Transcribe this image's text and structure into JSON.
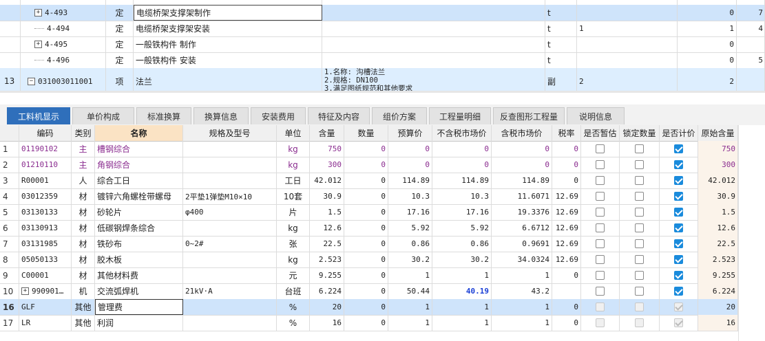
{
  "upper": {
    "rows": [
      {
        "num": "",
        "toggle": "+",
        "code": "4-493",
        "type": "定",
        "name": "电缆桥架支撑架制作",
        "spec": "",
        "unit": "t",
        "qty": "",
        "total": "0",
        "extra": "7",
        "selected": true
      },
      {
        "num": "",
        "toggle": "",
        "code": "4-494",
        "type": "定",
        "name": "电缆桥架支撑架安装",
        "spec": "",
        "unit": "t",
        "qty": "1",
        "total": "1",
        "extra": "4",
        "selected": false
      },
      {
        "num": "",
        "toggle": "+",
        "code": "4-495",
        "type": "定",
        "name": "一般铁构件 制作",
        "spec": "",
        "unit": "t",
        "qty": "",
        "total": "0",
        "extra": "",
        "selected": false
      },
      {
        "num": "",
        "toggle": "",
        "code": "4-496",
        "type": "定",
        "name": "一般铁构件 安装",
        "spec": "",
        "unit": "t",
        "qty": "",
        "total": "0",
        "extra": "5",
        "selected": false
      }
    ],
    "item": {
      "num": "13",
      "toggle": "−",
      "code": "031003011001",
      "type": "项",
      "name": "法兰",
      "spec_lines": [
        "1.名称: 沟槽法兰",
        "2.规格: DN100",
        "3.满足图纸规范和其他要求"
      ],
      "unit": "副",
      "qty": "2",
      "total": "2"
    }
  },
  "tabs": [
    "工料机显示",
    "单价构成",
    "标准换算",
    "换算信息",
    "安装费用",
    "特征及内容",
    "组价方案",
    "工程量明细",
    "反查图形工程量",
    "说明信息"
  ],
  "grid": {
    "headers": [
      "",
      "编码",
      "类别",
      "名称",
      "规格及型号",
      "单位",
      "含量",
      "数量",
      "预算价",
      "不含税市场价",
      "含税市场价",
      "税率",
      "是否暂估",
      "锁定数量",
      "是否计价",
      "原始含量"
    ],
    "rows": [
      {
        "n": "1",
        "code": "01190102",
        "cat": "主",
        "name": "槽钢综合",
        "spec": "",
        "unit": "kg",
        "content": "750",
        "qty": "0",
        "budget": "0",
        "mkt_ex": "0",
        "mkt_in": "0",
        "tax": "0",
        "est": false,
        "lock": false,
        "priced": true,
        "orig": "750",
        "purple": true
      },
      {
        "n": "2",
        "code": "01210110",
        "cat": "主",
        "name": "角钢综合",
        "spec": "",
        "unit": "kg",
        "content": "300",
        "qty": "0",
        "budget": "0",
        "mkt_ex": "0",
        "mkt_in": "0",
        "tax": "0",
        "est": false,
        "lock": false,
        "priced": true,
        "orig": "300",
        "purple": true
      },
      {
        "n": "3",
        "code": "R00001",
        "cat": "人",
        "name": "综合工日",
        "spec": "",
        "unit": "工日",
        "content": "42.012",
        "qty": "0",
        "budget": "114.89",
        "mkt_ex": "114.89",
        "mkt_in": "114.89",
        "tax": "0",
        "est": false,
        "lock": false,
        "priced": true,
        "orig": "42.012"
      },
      {
        "n": "4",
        "code": "03012359",
        "cat": "材",
        "name": "镀锌六角螺栓带螺母",
        "spec": "2平垫1弹垫M10×10",
        "unit": "10套",
        "content": "30.9",
        "qty": "0",
        "budget": "10.3",
        "mkt_ex": "10.3",
        "mkt_in": "11.6071",
        "tax": "12.69",
        "est": false,
        "lock": false,
        "priced": true,
        "orig": "30.9"
      },
      {
        "n": "5",
        "code": "03130133",
        "cat": "材",
        "name": "砂轮片",
        "spec": "φ400",
        "unit": "片",
        "content": "1.5",
        "qty": "0",
        "budget": "17.16",
        "mkt_ex": "17.16",
        "mkt_in": "19.3376",
        "tax": "12.69",
        "est": false,
        "lock": false,
        "priced": true,
        "orig": "1.5"
      },
      {
        "n": "6",
        "code": "03130913",
        "cat": "材",
        "name": "低碳钢焊条综合",
        "spec": "",
        "unit": "kg",
        "content": "12.6",
        "qty": "0",
        "budget": "5.92",
        "mkt_ex": "5.92",
        "mkt_in": "6.6712",
        "tax": "12.69",
        "est": false,
        "lock": false,
        "priced": true,
        "orig": "12.6"
      },
      {
        "n": "7",
        "code": "03131985",
        "cat": "材",
        "name": "铁砂布",
        "spec": "0~2#",
        "unit": "张",
        "content": "22.5",
        "qty": "0",
        "budget": "0.86",
        "mkt_ex": "0.86",
        "mkt_in": "0.9691",
        "tax": "12.69",
        "est": false,
        "lock": false,
        "priced": true,
        "orig": "22.5"
      },
      {
        "n": "8",
        "code": "05050133",
        "cat": "材",
        "name": "胶木板",
        "spec": "",
        "unit": "kg",
        "content": "2.523",
        "qty": "0",
        "budget": "30.2",
        "mkt_ex": "30.2",
        "mkt_in": "34.0324",
        "tax": "12.69",
        "est": false,
        "lock": false,
        "priced": true,
        "orig": "2.523"
      },
      {
        "n": "9",
        "code": "C00001",
        "cat": "材",
        "name": "其他材料费",
        "spec": "",
        "unit": "元",
        "content": "9.255",
        "qty": "0",
        "budget": "1",
        "mkt_ex": "1",
        "mkt_in": "1",
        "tax": "0",
        "est": false,
        "lock": false,
        "priced": true,
        "orig": "9.255"
      },
      {
        "n": "10",
        "code": "990901…",
        "cat": "机",
        "name": "交流弧焊机",
        "spec": "21kV·A",
        "unit": "台班",
        "content": "6.224",
        "qty": "0",
        "budget": "50.44",
        "mkt_ex": "40.19",
        "mkt_in": "43.2",
        "tax": "",
        "est": false,
        "lock": false,
        "priced": true,
        "orig": "6.224",
        "toggle": "+",
        "bluebold": true
      },
      {
        "n": "16",
        "code": "GLF",
        "cat": "其他",
        "name": "管理费",
        "spec": "",
        "unit": "%",
        "content": "20",
        "qty": "0",
        "budget": "1",
        "mkt_ex": "1",
        "mkt_in": "1",
        "tax": "0",
        "est": false,
        "lock": false,
        "priced": true,
        "orig": "20",
        "selected": true,
        "disabled": true,
        "boldnum": true
      },
      {
        "n": "17",
        "code": "LR",
        "cat": "其他",
        "name": "利润",
        "spec": "",
        "unit": "%",
        "content": "16",
        "qty": "0",
        "budget": "1",
        "mkt_ex": "1",
        "mkt_in": "1",
        "tax": "0",
        "est": false,
        "lock": false,
        "priced": true,
        "orig": "16",
        "disabled": true
      }
    ]
  }
}
